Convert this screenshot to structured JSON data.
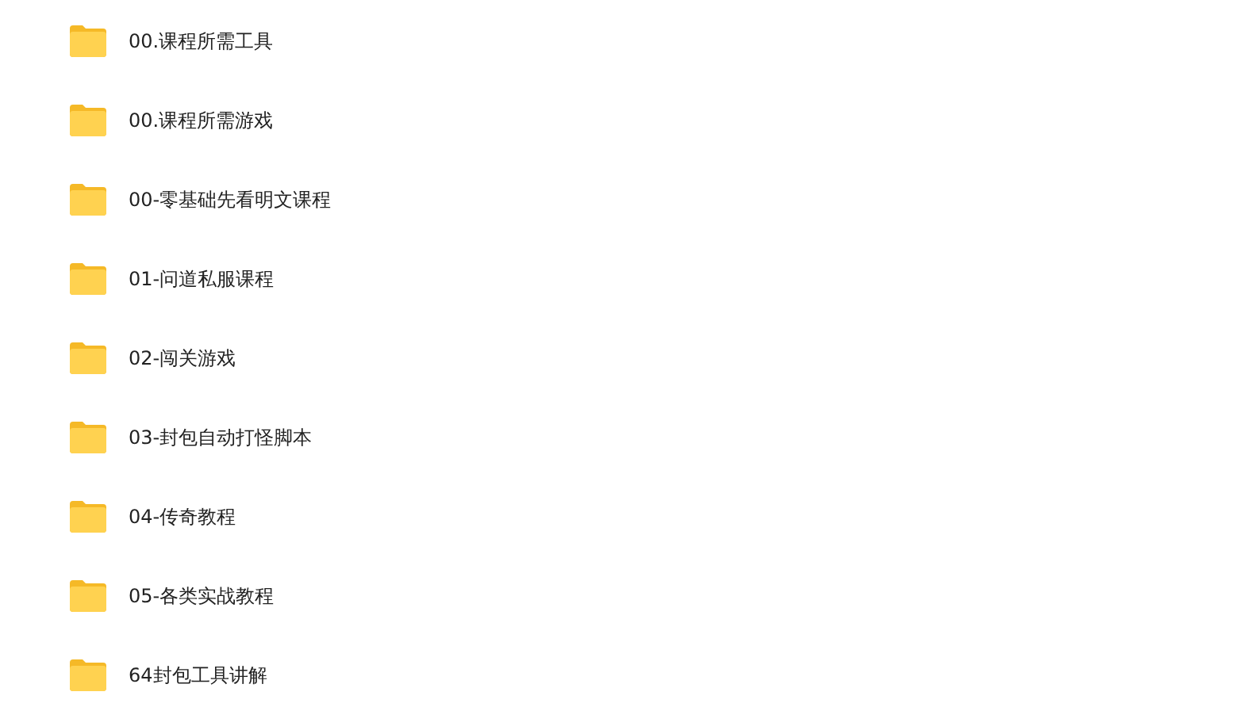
{
  "folders": [
    {
      "name": "00.课程所需工具"
    },
    {
      "name": "00.课程所需游戏"
    },
    {
      "name": "00-零基础先看明文课程"
    },
    {
      "name": "01-问道私服课程"
    },
    {
      "name": "02-闯关游戏"
    },
    {
      "name": "03-封包自动打怪脚本"
    },
    {
      "name": "04-传奇教程"
    },
    {
      "name": "05-各类实战教程"
    },
    {
      "name": "64封包工具讲解"
    }
  ]
}
